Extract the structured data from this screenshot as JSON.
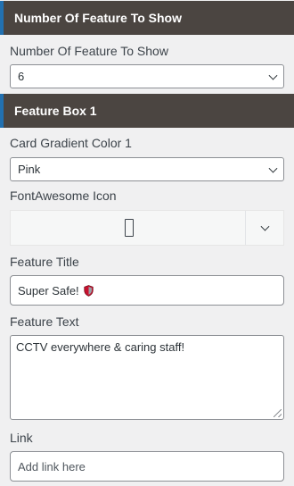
{
  "section1": {
    "header": "Number Of Feature To Show",
    "label": "Number Of Feature To Show",
    "selected": "6"
  },
  "section2": {
    "header": "Feature Box 1",
    "gradient_label": "Card Gradient Color 1",
    "gradient_selected": "Pink",
    "icon_label": "FontAwesome Icon",
    "icon_name": "placeholder-icon",
    "title_label": "Feature Title",
    "title_value": "Super Safe!",
    "title_emoji": "shield-icon",
    "text_label": "Feature Text",
    "text_value": "CCTV everywhere & caring staff!",
    "link_label": "Link",
    "link_placeholder": "Add link here"
  },
  "colors": {
    "header_bg": "#4b4541",
    "accent": "#2271b1",
    "shield_red": "#c8102e"
  }
}
